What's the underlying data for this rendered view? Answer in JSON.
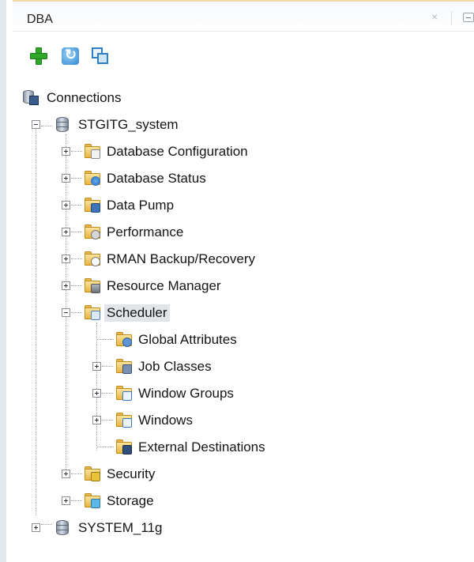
{
  "panel": {
    "title": "DBA",
    "close_glyph": "×"
  },
  "toolbar": {
    "buttons": [
      {
        "icon": "add-connection-icon"
      },
      {
        "icon": "refresh-icon"
      },
      {
        "icon": "collapse-all-icon"
      }
    ]
  },
  "tree": {
    "root": "Connections",
    "connections": [
      {
        "name": "STGITG_system",
        "expanded": true,
        "children": [
          {
            "label": "Database Configuration",
            "icon": "config-folder-icon",
            "expanded": false
          },
          {
            "label": "Database Status",
            "icon": "status-folder-icon",
            "expanded": false
          },
          {
            "label": "Data Pump",
            "icon": "data-pump-folder-icon",
            "expanded": false
          },
          {
            "label": "Performance",
            "icon": "performance-folder-icon",
            "expanded": false
          },
          {
            "label": "RMAN Backup/Recovery",
            "icon": "rman-folder-icon",
            "expanded": false
          },
          {
            "label": "Resource Manager",
            "icon": "resource-manager-folder-icon",
            "expanded": false
          },
          {
            "label": "Scheduler",
            "icon": "scheduler-folder-icon",
            "expanded": true,
            "selected": true,
            "children": [
              {
                "label": "Global Attributes",
                "icon": "global-attributes-icon",
                "leaf": true
              },
              {
                "label": "Job Classes",
                "icon": "job-classes-folder-icon",
                "expanded": false
              },
              {
                "label": "Window Groups",
                "icon": "window-groups-folder-icon",
                "expanded": false
              },
              {
                "label": "Windows",
                "icon": "windows-folder-icon",
                "expanded": false
              },
              {
                "label": "External Destinations",
                "icon": "external-destinations-icon",
                "leaf": true
              }
            ]
          },
          {
            "label": "Security",
            "icon": "security-folder-icon",
            "expanded": false
          },
          {
            "label": "Storage",
            "icon": "storage-folder-icon",
            "expanded": false
          }
        ]
      },
      {
        "name": "SYSTEM_11g",
        "expanded": false
      }
    ]
  },
  "colors": {
    "selection": "#e1e4e9",
    "add_green": "#2fa82a",
    "accent_blue": "#2f86d2"
  }
}
